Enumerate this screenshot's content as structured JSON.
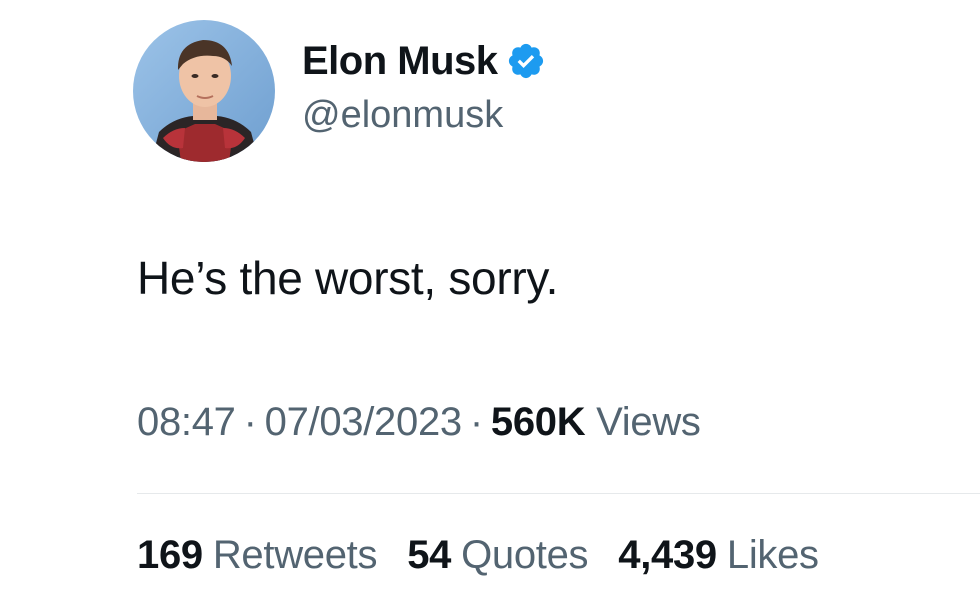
{
  "author": {
    "display_name": "Elon Musk",
    "handle": "@elonmusk",
    "verified_icon": "verified-badge-icon",
    "badge_color": "#1d9bf0"
  },
  "tweet": {
    "text": "He’s the worst, sorry."
  },
  "meta": {
    "time": "08:47",
    "separator": "·",
    "date": "07/03/2023",
    "views_count": "560K",
    "views_label": "Views"
  },
  "stats": {
    "retweets_count": "169",
    "retweets_label": "Retweets",
    "quotes_count": "54",
    "quotes_label": "Quotes",
    "likes_count": "4,439",
    "likes_label": "Likes"
  },
  "colors": {
    "text_primary": "#0f1419",
    "text_secondary": "#536471",
    "divider": "#e6e9eb"
  }
}
